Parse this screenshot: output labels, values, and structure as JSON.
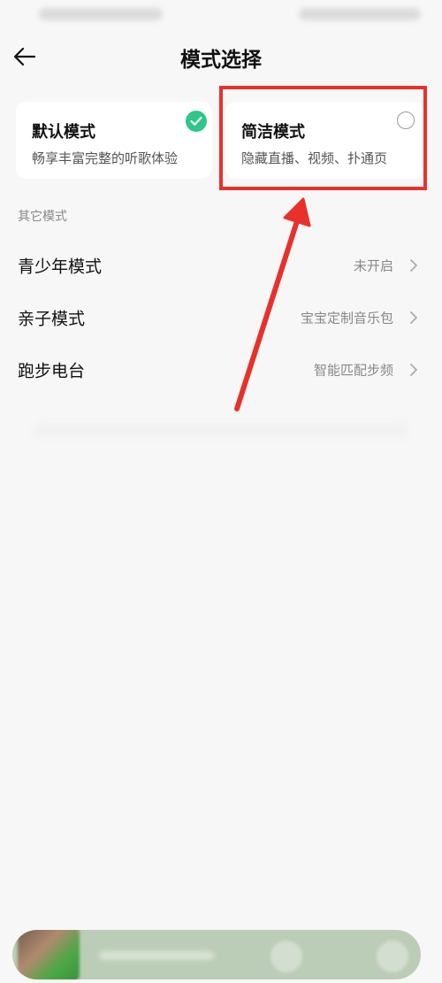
{
  "header": {
    "title": "模式选择",
    "back_icon": "arrow-left-icon"
  },
  "mode_cards": [
    {
      "title": "默认模式",
      "description": "畅享丰富完整的听歌体验",
      "selected": true,
      "indicator_icon": "check-circle-icon"
    },
    {
      "title": "简洁模式",
      "description": "隐藏直播、视频、扑通页",
      "selected": false,
      "indicator_icon": "radio-empty-icon"
    }
  ],
  "section": {
    "label": "其它模式"
  },
  "other_modes": [
    {
      "label": "青少年模式",
      "value": "未开启"
    },
    {
      "label": "亲子模式",
      "value": "宝宝定制音乐包"
    },
    {
      "label": "跑步电台",
      "value": "智能匹配步频"
    }
  ],
  "colors": {
    "accent_green": "#2fc68a",
    "annotation_red": "#e8312b",
    "background": "#f7f7f7",
    "player_bar": "#bccdb7"
  }
}
